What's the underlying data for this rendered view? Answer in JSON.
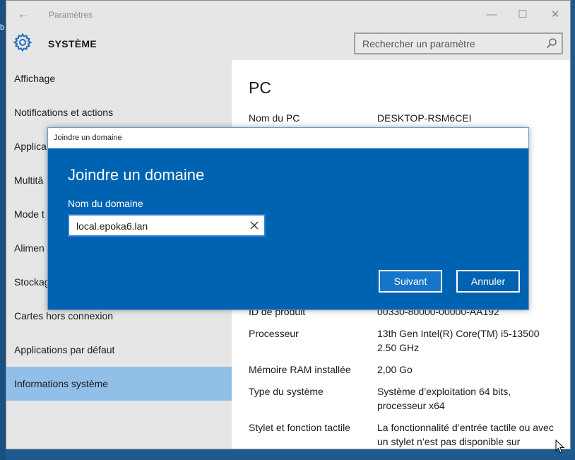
{
  "window": {
    "title": "Paramètres",
    "back_glyph": "←",
    "minimize_glyph": "—",
    "maximize_glyph": "☐",
    "close_glyph": "✕"
  },
  "header": {
    "title": "SYSTÈME",
    "icon": "gear-icon",
    "search_placeholder": "Rechercher un paramètre"
  },
  "desktop": {
    "edge_text": "b"
  },
  "sidebar": {
    "items": [
      {
        "label": "Affichage",
        "active": false
      },
      {
        "label": "Notifications et actions",
        "active": false
      },
      {
        "label": "Applica",
        "active": false
      },
      {
        "label": "Multitâ",
        "active": false
      },
      {
        "label": "Mode t",
        "active": false
      },
      {
        "label": "Alimen",
        "active": false
      },
      {
        "label": "Stockag",
        "active": false
      },
      {
        "label": "Cartes hors connexion",
        "active": false
      },
      {
        "label": "Applications par défaut",
        "active": false
      },
      {
        "label": "Informations système",
        "active": true
      }
    ]
  },
  "content": {
    "title": "PC",
    "rows": [
      {
        "label": "Nom du PC",
        "value": "DESKTOP-RSM6CEI"
      },
      {
        "label": "ID de produit",
        "value": "00330-80000-00000-AA192"
      },
      {
        "label": "Processeur",
        "value": "13th Gen Intel(R) Core(TM) i5-13500 2.50 GHz"
      },
      {
        "label": "Mémoire RAM installée",
        "value": "2,00 Go"
      },
      {
        "label": "Type du système",
        "value": "Système d’exploitation 64 bits, processeur x64"
      },
      {
        "label": "Stylet et fonction tactile",
        "value": "La fonctionnalité d’entrée tactile ou avec un stylet n’est pas disponible sur"
      }
    ]
  },
  "dialog": {
    "window_title": "Joindre un domaine",
    "heading": "Joindre un domaine",
    "field_label": "Nom du domaine",
    "field_value": "local.epoka6.lan",
    "next_label": "Suivant",
    "cancel_label": "Annuler"
  },
  "colors": {
    "dialog_bg": "#0063b1",
    "accent": "#0078d7",
    "sidebar_active": "#91bfe7",
    "desktop": "#1f5a8e"
  }
}
